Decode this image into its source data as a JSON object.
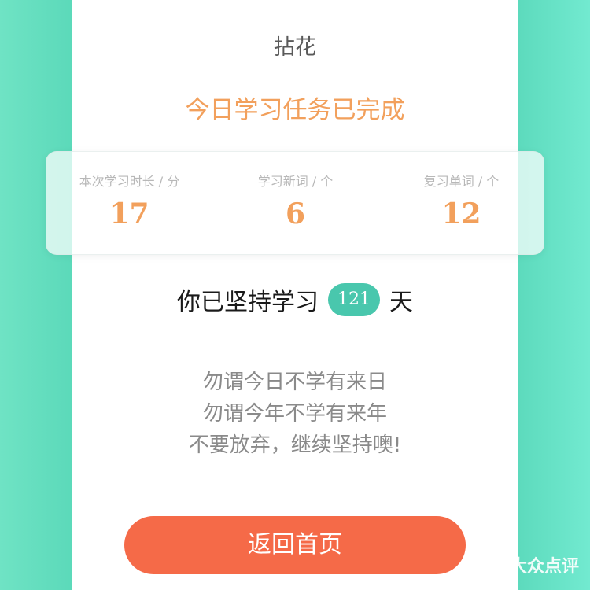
{
  "header": {
    "username": "拈花",
    "task_status": "今日学习任务已完成"
  },
  "stats": [
    {
      "label": "本次学习时长 / 分",
      "value": "17"
    },
    {
      "label": "学习新词 / 个",
      "value": "6"
    },
    {
      "label": "复习单词 / 个",
      "value": "12"
    }
  ],
  "streak": {
    "prefix": "你已坚持学习",
    "days": "121",
    "suffix": "天"
  },
  "quote": {
    "line1": "勿谓今日不学有来日",
    "line2": "勿谓今年不学有来年",
    "line3": "不要放弃，继续坚持噢!"
  },
  "actions": {
    "home_label": "返回首页"
  },
  "watermark": {
    "text": "大众点评",
    "icon": "dianping-logo"
  },
  "colors": {
    "accent_orange": "#f2a05c",
    "button": "#f56a48",
    "badge": "#49c7ad",
    "background": "#4fd3b3"
  }
}
